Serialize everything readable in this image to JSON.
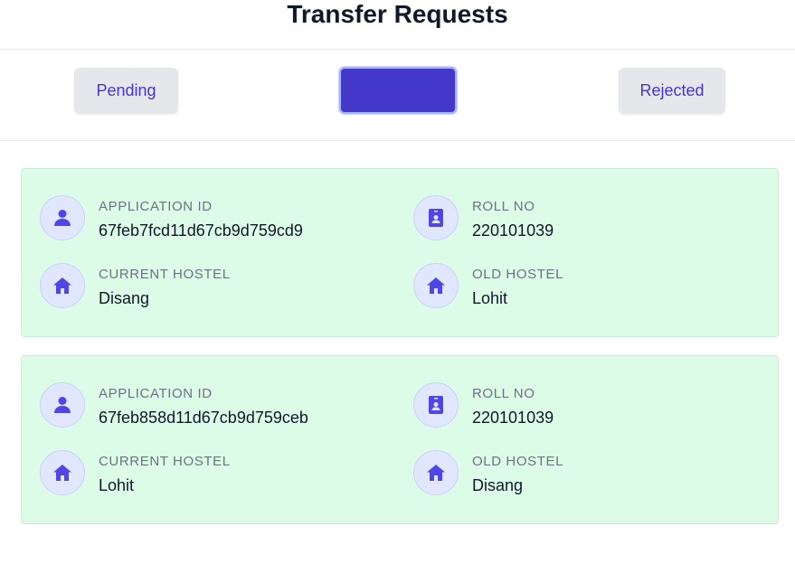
{
  "header": {
    "title": "Transfer Requests"
  },
  "tabs": {
    "pending_label": "Pending",
    "approved_label": "",
    "rejected_label": "Rejected"
  },
  "requests": [
    {
      "application_id_label": "APPLICATION ID",
      "application_id": "67feb7fcd11d67cb9d759cd9",
      "roll_no_label": "ROLL NO",
      "roll_no": "220101039",
      "current_hostel_label": "CURRENT HOSTEL",
      "current_hostel": "Disang",
      "old_hostel_label": "OLD HOSTEL",
      "old_hostel": "Lohit"
    },
    {
      "application_id_label": "APPLICATION ID",
      "application_id": "67feb858d11d67cb9d759ceb",
      "roll_no_label": "ROLL NO",
      "roll_no": "220101039",
      "current_hostel_label": "CURRENT HOSTEL",
      "current_hostel": "Lohit",
      "old_hostel_label": "OLD HOSTEL",
      "old_hostel": "Disang"
    }
  ],
  "icons": {
    "application_id": "user-icon",
    "roll_no": "id-badge-icon",
    "current_hostel": "home-icon",
    "old_hostel": "home-icon"
  },
  "colors": {
    "accent": "#4338ca",
    "card_bg": "#dcfce7",
    "icon_bg": "#e0e7ff"
  }
}
